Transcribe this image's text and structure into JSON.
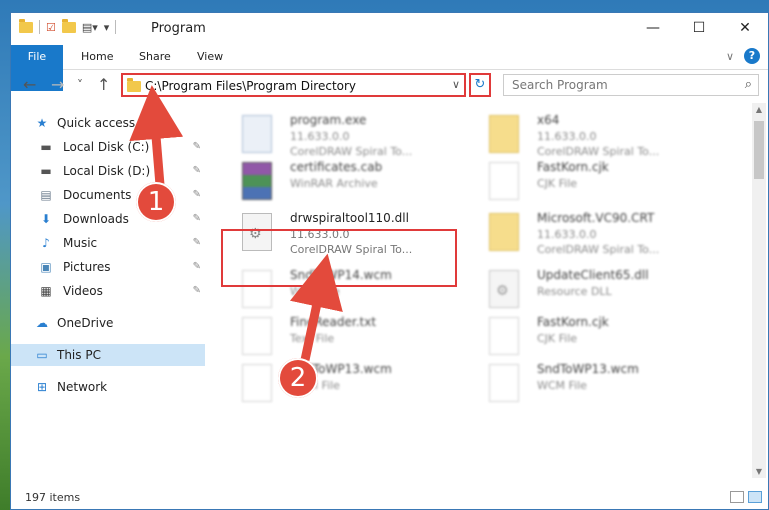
{
  "window": {
    "title": "Program",
    "quick_access_toolbar": [
      "folder-icon",
      "properties-icon",
      "new-folder-icon",
      "customize-icon"
    ],
    "caption_buttons": {
      "minimize": "—",
      "maximize": "☐",
      "close": "✕"
    }
  },
  "ribbon": {
    "tabs": [
      {
        "label": "File",
        "active": true
      },
      {
        "label": "Home",
        "active": false
      },
      {
        "label": "Share",
        "active": false
      },
      {
        "label": "View",
        "active": false
      }
    ],
    "expand_glyph": "∨",
    "help_glyph": "?"
  },
  "navigation": {
    "back": "←",
    "forward": "→",
    "recent": "˅",
    "up": "↑",
    "address": "C:\\Program Files\\Program Directory",
    "address_dropdown": "∨",
    "refresh": "↻",
    "search_placeholder": "Search Program",
    "search_glyph": "⌕"
  },
  "sidebar": {
    "items": [
      {
        "label": "Quick access",
        "icon": "star-icon",
        "glyph": "★",
        "color": "#2a7fd0",
        "pinned": false,
        "level": 0
      },
      {
        "label": "Local Disk (C:)",
        "icon": "drive-icon",
        "glyph": "▬",
        "color": "#555555",
        "pinned": true,
        "level": 1
      },
      {
        "label": "Local Disk (D:)",
        "icon": "drive-icon",
        "glyph": "▬",
        "color": "#555555",
        "pinned": true,
        "level": 1
      },
      {
        "label": "Documents",
        "icon": "documents-icon",
        "glyph": "▤",
        "color": "#6b7b8c",
        "pinned": true,
        "level": 1
      },
      {
        "label": "Downloads",
        "icon": "downloads-icon",
        "glyph": "⬇",
        "color": "#2a7fd0",
        "pinned": true,
        "level": 1
      },
      {
        "label": "Music",
        "icon": "music-icon",
        "glyph": "♪",
        "color": "#2a7fd0",
        "pinned": true,
        "level": 1
      },
      {
        "label": "Pictures",
        "icon": "pictures-icon",
        "glyph": "▣",
        "color": "#4a86b8",
        "pinned": true,
        "level": 1
      },
      {
        "label": "Videos",
        "icon": "videos-icon",
        "glyph": "▦",
        "color": "#444444",
        "pinned": true,
        "level": 1
      },
      {
        "label": "OneDrive",
        "icon": "cloud-icon",
        "glyph": "☁",
        "color": "#2a7fd0",
        "pinned": false,
        "level": 0
      },
      {
        "label": "This PC",
        "icon": "computer-icon",
        "glyph": "▭",
        "color": "#2a7fd0",
        "pinned": false,
        "level": 0,
        "selected": true
      },
      {
        "label": "Network",
        "icon": "network-icon",
        "glyph": "⊞",
        "color": "#2a7fd0",
        "pinned": false,
        "level": 0
      }
    ],
    "pin_glyph": "📌"
  },
  "files": [
    {
      "name": "program.exe",
      "line2": "11.633.0.0",
      "line3": "CorelDRAW Spiral To...",
      "type": "exe",
      "col": 0,
      "row": 0
    },
    {
      "name": "x64",
      "line2": "11.633.0.0",
      "line3": "CorelDRAW Spiral To...",
      "type": "folder",
      "col": 1,
      "row": 0
    },
    {
      "name": "certificates.cab",
      "line2": "WinRAR Archive",
      "line3": "",
      "type": "rar",
      "col": 0,
      "row": 1
    },
    {
      "name": "FastKorn.cjk",
      "line2": "CJK File",
      "line3": "",
      "type": "doc",
      "col": 1,
      "row": 1
    },
    {
      "name": "drwspiraltool110.dll",
      "line2": "11.633.0.0",
      "line3": "CorelDRAW Spiral To...",
      "type": "dll",
      "col": 0,
      "row": 2,
      "highlighted": true
    },
    {
      "name": "Microsoft.VC90.CRT",
      "line2": "11.633.0.0",
      "line3": "CorelDRAW Spiral To...",
      "type": "folder",
      "col": 1,
      "row": 2
    },
    {
      "name": "SndToWP14.wcm",
      "line2": "WCM File",
      "line3": "",
      "type": "doc",
      "col": 0,
      "row": 3
    },
    {
      "name": "UpdateClient65.dll",
      "line2": "Resource DLL",
      "line3": "",
      "type": "dll",
      "col": 1,
      "row": 3
    },
    {
      "name": "FineReader.txt",
      "line2": "Text File",
      "line3": "",
      "type": "doc",
      "col": 0,
      "row": 4
    },
    {
      "name": "FastKorn.cjk",
      "line2": "CJK File",
      "line3": "",
      "type": "doc",
      "col": 1,
      "row": 4
    },
    {
      "name": "SndToWP13.wcm",
      "line2": "WCM File",
      "line3": "",
      "type": "doc",
      "col": 0,
      "row": 5
    },
    {
      "name": "SndToWP13.wcm",
      "line2": "WCM File",
      "line3": "",
      "type": "doc",
      "col": 1,
      "row": 5
    }
  ],
  "status": {
    "count": "197 items"
  },
  "callouts": [
    {
      "label": "1"
    },
    {
      "label": "2"
    }
  ],
  "colors": {
    "accent": "#1979ca",
    "highlight": "#e03a3a",
    "callout": "#e34a3c",
    "selected": "#cce4f7"
  }
}
